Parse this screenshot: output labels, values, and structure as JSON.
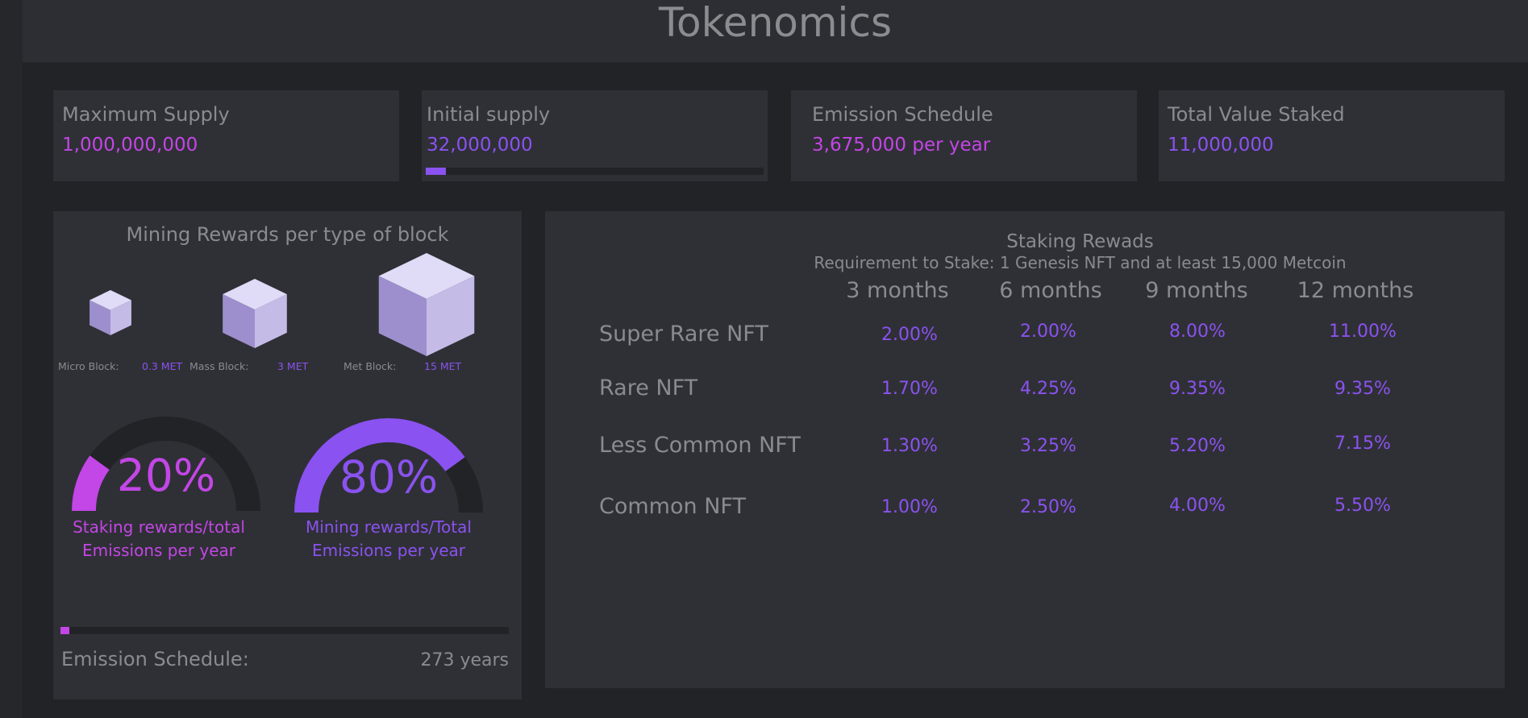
{
  "header": {
    "title": "Tokenomics"
  },
  "stats": [
    {
      "label": "Maximum Supply",
      "value": "1,000,000,000",
      "color": "#c346e6"
    },
    {
      "label": "Initial supply",
      "value": "32,000,000",
      "color": "#8a52f0",
      "progress": 0.032
    },
    {
      "label": "Emission Schedule",
      "value": "3,675,000 per year",
      "color": "#c346e6"
    },
    {
      "label": "Total Value Staked",
      "value": "11,000,000",
      "color": "#8a52f0"
    }
  ],
  "mining": {
    "title": "Mining Rewards per type of block",
    "blocks": [
      {
        "label": "Micro Block:",
        "value": "0.3 MET",
        "icon": "cube-icon"
      },
      {
        "label": "Mass Block:",
        "value": "3 MET",
        "icon": "cube-icon"
      },
      {
        "label": "Met Block:",
        "value": "15 MET",
        "icon": "cube-icon"
      }
    ],
    "gauges": [
      {
        "percent": "20%",
        "fraction": 0.2,
        "caption_line1": "Staking rewards/total",
        "caption_line2": "Emissions per year",
        "color": "#c346e6"
      },
      {
        "percent": "80%",
        "fraction": 0.8,
        "caption_line1": "Mining rewards/Total",
        "caption_line2": "Emissions per year",
        "color": "#8a52f0"
      }
    ],
    "emission_label": "Emission Schedule:",
    "emission_years": "273 years",
    "emission_progress": 0.02
  },
  "staking": {
    "title": "Staking Rewads",
    "subtitle": "Requirement to Stake: 1 Genesis NFT and at least 15,000 Metcoin",
    "columns": [
      "3 months",
      "6 months",
      "9 months",
      "12 months"
    ],
    "rows": [
      {
        "label": "Super Rare NFT",
        "values": [
          "2.00%",
          "2.00%",
          "8.00%",
          "11.00%"
        ]
      },
      {
        "label": "Rare NFT",
        "values": [
          "1.70%",
          "4.25%",
          "9.35%",
          "9.35%"
        ]
      },
      {
        "label": "Less Common NFT",
        "values": [
          "1.30%",
          "3.25%",
          "5.20%",
          "7.15%"
        ]
      },
      {
        "label": "Common NFT",
        "values": [
          "1.00%",
          "2.50%",
          "4.00%",
          "5.50%"
        ]
      }
    ]
  },
  "colors": {
    "magenta": "#c346e6",
    "purple": "#8a52f0",
    "track": "#222327"
  }
}
